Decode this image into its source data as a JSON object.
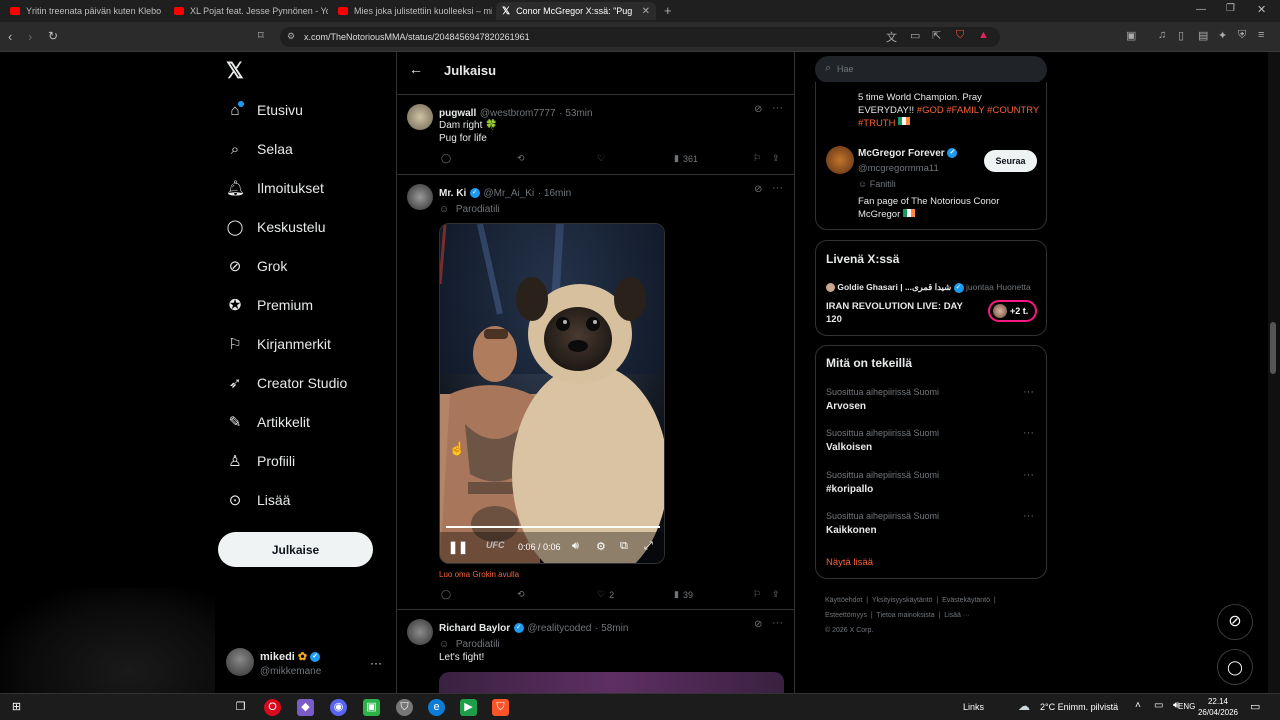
{
  "browser": {
    "tabs": [
      {
        "title": "Yritin treenata päivän kuten Klebo -",
        "color": "#ff0000",
        "active": false
      },
      {
        "title": "XL Pojat feat. Jesse Pynnönen - YouT",
        "color": "#ff0000",
        "active": false
      },
      {
        "title": "Mies joka julistettiin kuolleeksi – mitä",
        "color": "#ff0000",
        "active": false
      },
      {
        "title": "Conor McGregor X:ssä: \"Pug",
        "color": "#ffffff",
        "active": true
      }
    ],
    "url": "x.com/TheNotoriousMMA/status/2048456947820261961"
  },
  "sidebar": {
    "items": [
      {
        "label": "Etusivu",
        "icon": "home-icon"
      },
      {
        "label": "Selaa",
        "icon": "search-icon"
      },
      {
        "label": "Ilmoitukset",
        "icon": "bell-icon"
      },
      {
        "label": "Keskustelu",
        "icon": "chat-icon"
      },
      {
        "label": "Grok",
        "icon": "grok-icon"
      },
      {
        "label": "Premium",
        "icon": "premium-icon"
      },
      {
        "label": "Kirjanmerkit",
        "icon": "bookmark-icon"
      },
      {
        "label": "Creator Studio",
        "icon": "rocket-icon"
      },
      {
        "label": "Artikkelit",
        "icon": "article-icon"
      },
      {
        "label": "Profiili",
        "icon": "person-icon"
      },
      {
        "label": "Lisää",
        "icon": "more-icon"
      }
    ],
    "post_button": "Julkaise",
    "account": {
      "name": "mikedi",
      "handle": "@mikkemane"
    }
  },
  "main": {
    "header_title": "Julkaisu",
    "posts": [
      {
        "name": "pugwall",
        "handle": "@westbrom7777",
        "time": "· 53min",
        "lines": [
          "Dam right 🍀",
          "Pug for life"
        ],
        "views": "361",
        "likes": ""
      },
      {
        "name": "Mr. Ki",
        "handle": "@Mr_Ai_Ki",
        "time": "· 16min",
        "badge": "Parodiatili",
        "video_time": "0:06 / 0:06",
        "video_progress": 1.0,
        "grok_link": "Luo oma Grokin avulla",
        "likes": "2",
        "views": "39"
      },
      {
        "name": "Richard Baylor",
        "handle": "@realitycoded",
        "time": "· 58min",
        "badge": "Parodiatili",
        "lines": [
          "Let's fight!"
        ]
      }
    ]
  },
  "right": {
    "search_placeholder": "Hae",
    "bio_top": {
      "text": "5 time World Champion. Pray EVERYDAY!! ",
      "hashtags": "#GOD #FAMILY #COUNTRY #TRUTH"
    },
    "suggest": {
      "name": "McGregor Forever",
      "handle": "@mcgregormma11",
      "badge": "Fanitili",
      "bio": "Fan page of The Notorious Conor McGregor",
      "follow_label": "Seuraa"
    },
    "live": {
      "title": "Livenä X:ssä",
      "host": "Goldie Ghasari | ...شیدا قمری",
      "host_action": "juontaa Huonetta",
      "topic": "IRAN REVOLUTION LIVE: DAY 120",
      "listeners": "+2 t."
    },
    "trends": {
      "title": "Mitä on tekeillä",
      "items": [
        {
          "context": "Suosittua aihepiirissä Suomi",
          "name": "Arvosen"
        },
        {
          "context": "Suosittua aihepiirissä Suomi",
          "name": "Valkoisen"
        },
        {
          "context": "Suosittua aihepiirissä Suomi",
          "name": "#koripallo"
        },
        {
          "context": "Suosittua aihepiirissä Suomi",
          "name": "Kaikkonen"
        }
      ],
      "show_more": "Näytä lisää"
    },
    "footer": {
      "line1": [
        "Käyttöehdot",
        "Yksityisyyskäytäntö",
        "Evästekäytäntö"
      ],
      "line2": [
        "Esteettömyys",
        "Tietoa mainoksista",
        "Lisää ···"
      ],
      "copyright": "© 2026 X Corp."
    }
  },
  "taskbar": {
    "links_label": "Links",
    "weather": "2°C  Enimm. pilvistä",
    "lang": "ENG",
    "time": "22.14",
    "date": "26/04/2026"
  },
  "colors": {
    "accent": "#1d9bf0",
    "link_orange": "#f4633a",
    "bg": "#000000",
    "border": "#2f3336"
  }
}
